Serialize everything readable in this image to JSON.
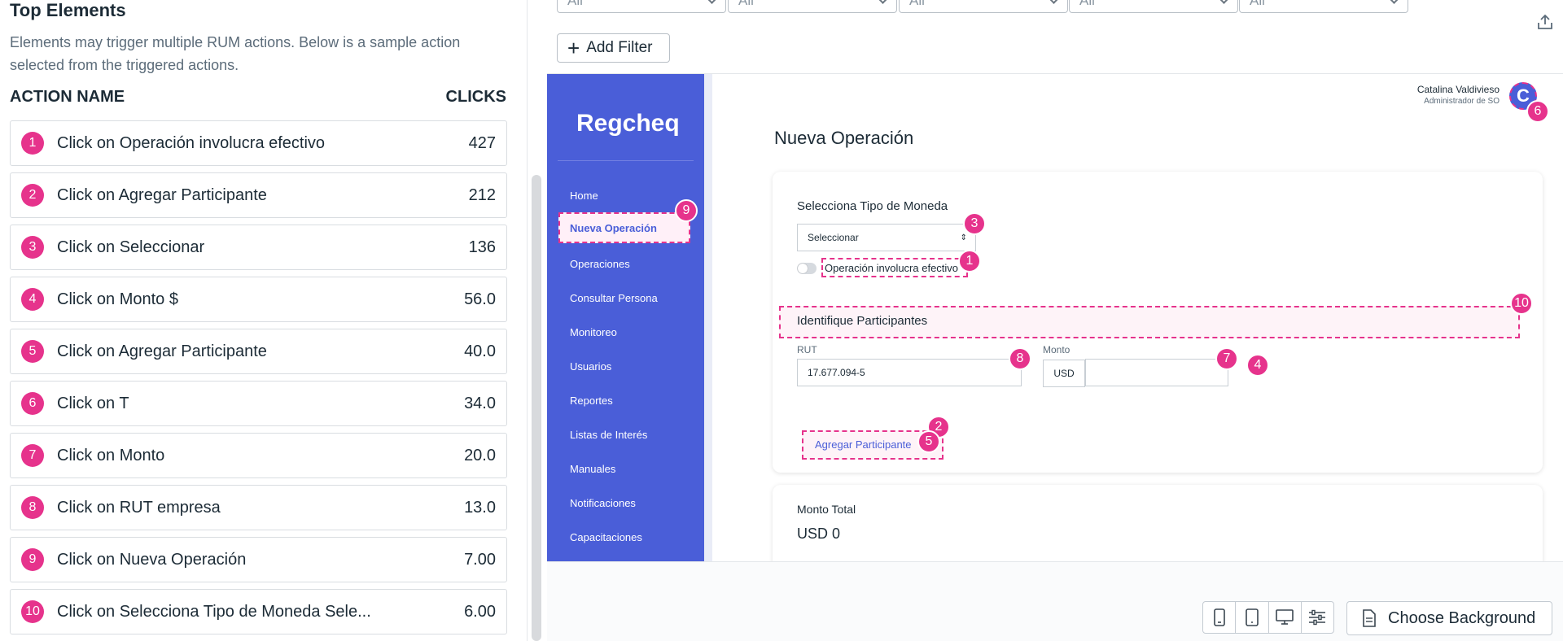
{
  "left": {
    "title": "Top Elements",
    "description": "Elements may trigger multiple RUM actions. Below is a sample action selected from the triggered actions.",
    "col_name": "ACTION NAME",
    "col_clicks": "CLICKS",
    "rows": [
      {
        "n": "1",
        "label": "Click on Operación involucra efectivo",
        "count": "427"
      },
      {
        "n": "2",
        "label": "Click on Agregar Participante",
        "count": "212"
      },
      {
        "n": "3",
        "label": "Click on Seleccionar",
        "count": "136"
      },
      {
        "n": "4",
        "label": "Click on Monto $",
        "count": "56.0"
      },
      {
        "n": "5",
        "label": "Click on Agregar Participante",
        "count": "40.0"
      },
      {
        "n": "6",
        "label": "Click on T",
        "count": "34.0"
      },
      {
        "n": "7",
        "label": "Click on Monto",
        "count": "20.0"
      },
      {
        "n": "8",
        "label": "Click on RUT empresa",
        "count": "13.0"
      },
      {
        "n": "9",
        "label": "Click on Nueva Operación",
        "count": "7.00"
      },
      {
        "n": "10",
        "label": "Click on Selecciona Tipo de Moneda Sele...",
        "count": "6.00"
      }
    ]
  },
  "filters": {
    "values": [
      "All",
      "All",
      "All",
      "All",
      "All"
    ],
    "add_filter": "Add Filter"
  },
  "app": {
    "logo": "Regcheq",
    "nav": [
      "Home",
      "Nueva Operación",
      "Operaciones",
      "Consultar Persona",
      "Monitoreo",
      "Usuarios",
      "Reportes",
      "Listas de Interés",
      "Manuales",
      "Notificaciones",
      "Capacitaciones"
    ],
    "user_name": "Catalina Valdivieso",
    "user_role": "Administrador de SO",
    "avatar_letter": "C",
    "page_title": "Nueva Operación",
    "currency_label": "Selecciona Tipo de Moneda",
    "currency_select": "Seleccionar",
    "cash_toggle_label": "Operación involucra efectivo",
    "participants_title": "Identifique Participantes",
    "rut_label": "RUT",
    "rut_value": "17.677.094-5",
    "monto_label": "Monto",
    "currency_tag": "USD",
    "add_participant": "Agregar Participante",
    "total_label": "Monto Total",
    "total_value": "USD 0"
  },
  "bottom": {
    "choose_background": "Choose Background"
  },
  "colors": {
    "accent": "#e6338c",
    "sidebar": "#4a5ed8"
  }
}
